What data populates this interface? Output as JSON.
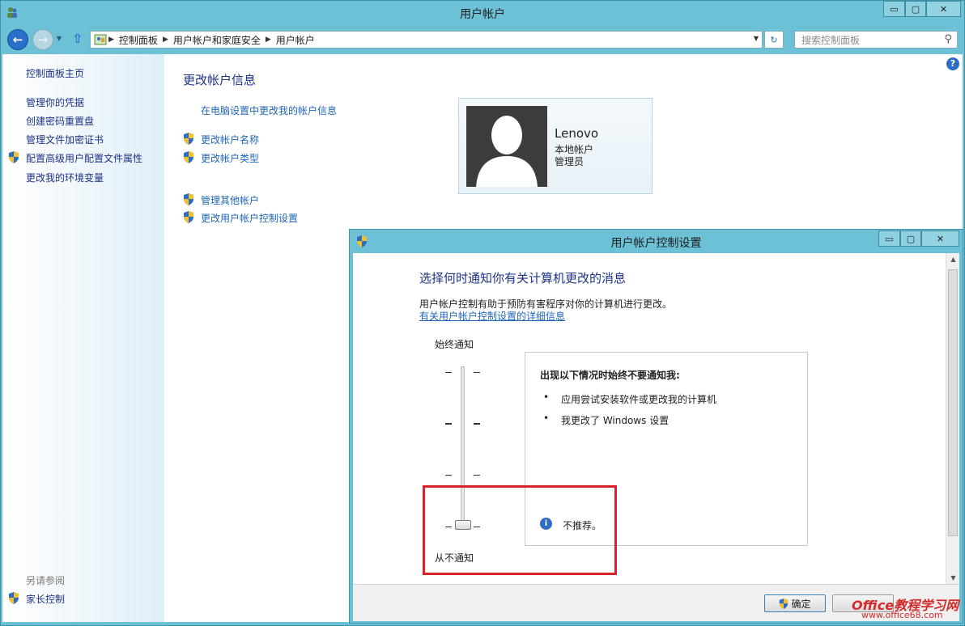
{
  "window": {
    "title": "用户帐户",
    "buttons": {
      "minimize": "▭",
      "restore": "▢",
      "close": "✕"
    }
  },
  "navbar": {
    "breadcrumbs": [
      "控制面板",
      "用户帐户和家庭安全",
      "用户帐户"
    ],
    "search_placeholder": "搜索控制面板"
  },
  "sidebar": {
    "home": "控制面板主页",
    "links": [
      "管理你的凭据",
      "创建密码重置盘",
      "管理文件加密证书",
      "配置高级用户配置文件属性",
      "更改我的环境变量"
    ],
    "see_also_heading": "另请参阅",
    "see_also_links": [
      "家长控制"
    ]
  },
  "main": {
    "heading": "更改帐户信息",
    "pc_settings_link": "在电脑设置中更改我的帐户信息",
    "links_group1": [
      "更改帐户名称",
      "更改帐户类型"
    ],
    "links_group2": [
      "管理其他帐户",
      "更改用户帐户控制设置"
    ],
    "user": {
      "name": "Lenovo",
      "type": "本地帐户",
      "role": "管理员"
    }
  },
  "dialog": {
    "title": "用户帐户控制设置",
    "heading": "选择何时通知你有关计算机更改的消息",
    "description": "用户帐户控制有助于预防有害程序对你的计算机进行更改。",
    "details_link": "有关用户帐户控制设置的详细信息",
    "slider": {
      "top_label": "始终通知",
      "bottom_label": "从不通知",
      "levels": 4,
      "selected_level": 1
    },
    "info_heading": "出现以下情况时始终不要通知我:",
    "info_bullets": [
      "应用尝试安装软件或更改我的计算机",
      "我更改了 Windows 设置"
    ],
    "info_note": "不推荐。",
    "ok_label": "确定"
  },
  "watermark": {
    "line1": "Office教程学习网",
    "line2": "www.office68.com"
  },
  "colors": {
    "accent": "#6cc1d6",
    "link": "#1e66b4",
    "heading": "#1e3287",
    "highlight": "#d9232a"
  }
}
